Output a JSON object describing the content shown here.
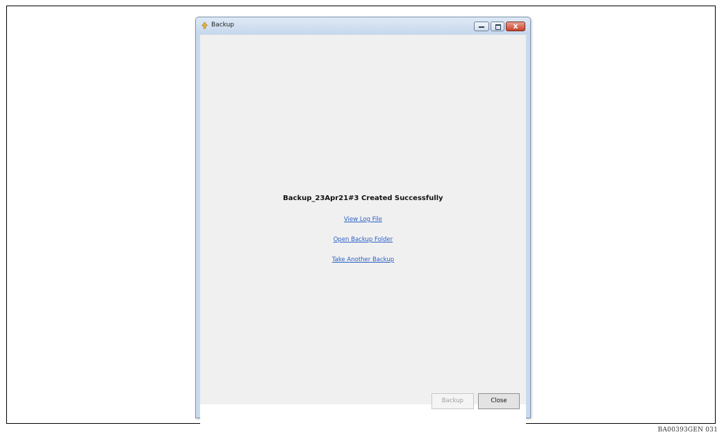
{
  "window": {
    "title": "Backup",
    "close_glyph": "x"
  },
  "content": {
    "headline": "Backup_23Apr21#3 Created Successfully",
    "links": {
      "view_log": "View Log File",
      "open_folder": "Open Backup Folder",
      "take_another": "Take Another Backup"
    }
  },
  "buttons": {
    "backup": "Backup",
    "close": "Close"
  },
  "figure": {
    "doc_id": "BA00393GEN  031"
  },
  "icons": {
    "app": "backup-app-icon",
    "minimize": "minimize-icon",
    "maximize": "maximize-icon",
    "close": "close-icon"
  },
  "colors": {
    "link": "#2a5fc5",
    "client_bg": "#f0f0f0",
    "close_button": "#c7412a"
  }
}
